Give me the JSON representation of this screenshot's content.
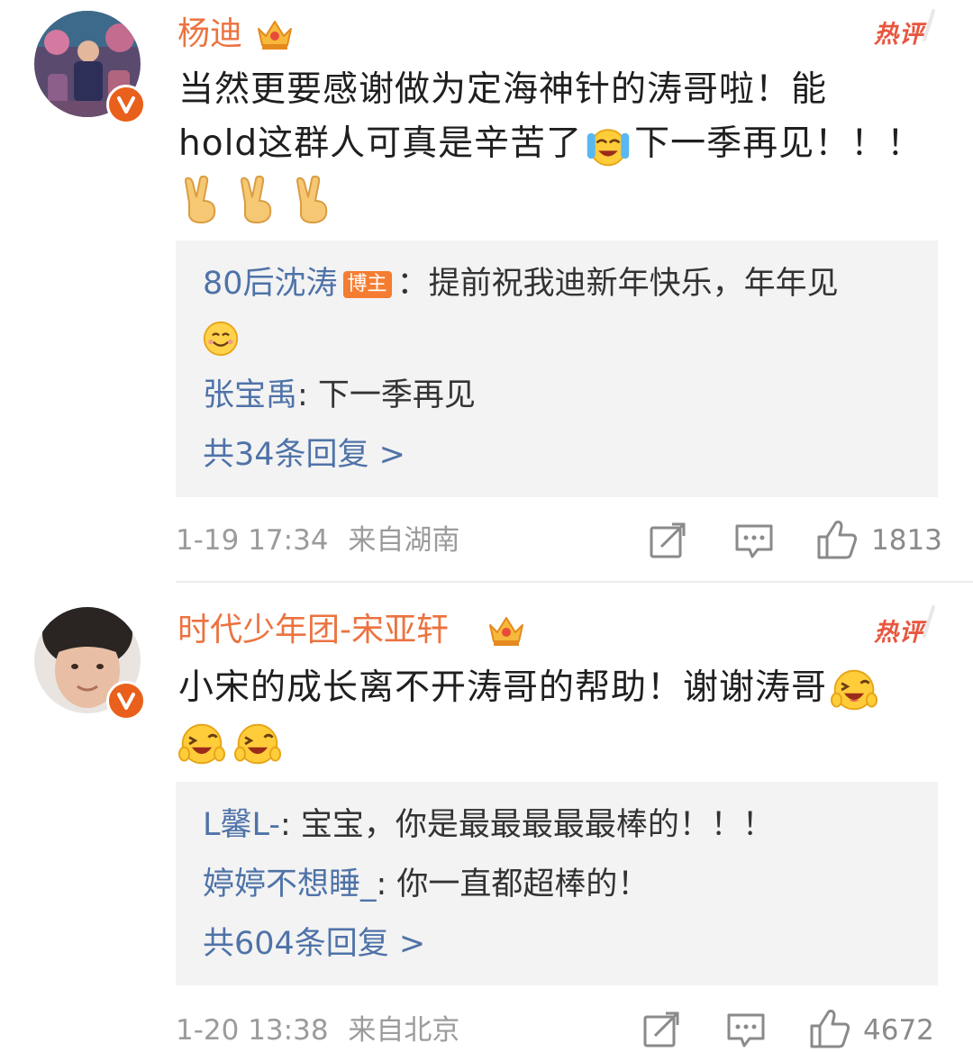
{
  "comments": [
    {
      "username": "杨迪",
      "hot_label": "热评",
      "text_line1": "当然更要感谢做为定海神针的涛哥啦！能",
      "text_line2a": "hold这群人可真是辛苦了",
      "text_line2b": "下一季再见！！！",
      "inline_emoji": "laughing-crying-emoji",
      "trailing_emoji": [
        "victory-hand-emoji",
        "victory-hand-emoji",
        "victory-hand-emoji"
      ],
      "replies": [
        {
          "user": "80后沈涛",
          "badge": "博主",
          "text": "：提前祝我迪新年快乐，年年见"
        },
        {
          "user": "张宝禹",
          "text": ": 下一季再见"
        }
      ],
      "total_replies": "共34条回复 >",
      "timestamp": "1-19 17:34",
      "source": "来自湖南",
      "likes": "1813"
    },
    {
      "username": "时代少年团-宋亚轩",
      "hot_label": "热评",
      "text_line1": "小宋的成长离不开涛哥的帮助！谢谢涛哥",
      "trailing_emoji": [
        "wink-laugh-emoji",
        "wink-laugh-emoji",
        "wink-laugh-emoji"
      ],
      "replies": [
        {
          "user": "L馨L-",
          "text": ": 宝宝，你是最最最最最棒的！！！"
        },
        {
          "user": "婷婷不想睡_",
          "text": ": 你一直都超棒的！"
        }
      ],
      "total_replies": "共604条回复 >",
      "timestamp": "1-20 13:38",
      "source": "来自北京",
      "likes": "4672"
    }
  ],
  "colors": {
    "username": "#eb7340",
    "reply_user": "#4f73a8",
    "reply_bg": "#f3f3f3",
    "meta": "#9b9b9b",
    "verified_badge": "#f5a623",
    "hot_label": "#e8563f"
  },
  "icons": {
    "share": "share-icon",
    "comment": "comment-icon",
    "like": "thumbs-up-icon",
    "verified": "verified-v-icon",
    "crown": "crown-icon"
  }
}
